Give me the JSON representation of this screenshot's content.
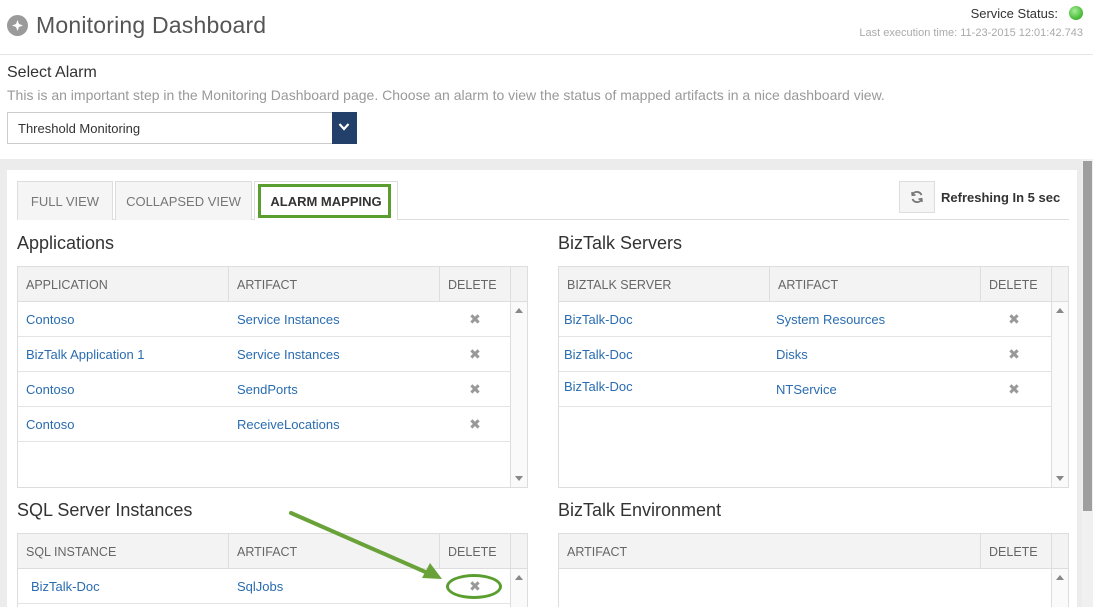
{
  "header": {
    "title": "Monitoring Dashboard",
    "service_status_label": "Service Status:",
    "last_execution": "Last execution time: 11-23-2015 12:01:42.743",
    "status_color": "#4fbf3c"
  },
  "select_alarm": {
    "title": "Select Alarm",
    "description": "This is an important step in the Monitoring Dashboard page. Choose an alarm to view the status of mapped artifacts in a nice dashboard view.",
    "selected": "Threshold Monitoring"
  },
  "tabs": [
    {
      "label": "FULL VIEW"
    },
    {
      "label": "COLLAPSED VIEW"
    },
    {
      "label": "ALARM MAPPING"
    }
  ],
  "refresh": {
    "text": "Refreshing In 5 sec",
    "icon": "refresh-icon"
  },
  "applications": {
    "title": "Applications",
    "headers": [
      "APPLICATION",
      "ARTIFACT",
      "DELETE"
    ],
    "rows": [
      {
        "app": "Contoso",
        "artifact": "Service Instances"
      },
      {
        "app": "BizTalk Application 1",
        "artifact": "Service Instances"
      },
      {
        "app": "Contoso",
        "artifact": "SendPorts"
      },
      {
        "app": "Contoso",
        "artifact": "ReceiveLocations"
      }
    ]
  },
  "biztalk_servers": {
    "title": "BizTalk Servers",
    "headers": [
      "BIZTALK SERVER",
      "ARTIFACT",
      "DELETE"
    ],
    "rows": [
      {
        "server": "BizTalk-Doc",
        "artifact": "System Resources"
      },
      {
        "server": "BizTalk-Doc",
        "artifact": "Disks"
      },
      {
        "server": "BizTalk-Doc",
        "artifact": "NTService"
      }
    ]
  },
  "sql_instances": {
    "title": "SQL Server Instances",
    "headers": [
      "SQL INSTANCE",
      "ARTIFACT",
      "DELETE"
    ],
    "rows": [
      {
        "instance": "BizTalk-Doc",
        "artifact": "SqlJobs"
      }
    ]
  },
  "biztalk_environment": {
    "title": "BizTalk Environment",
    "headers": [
      "ARTIFACT",
      "DELETE"
    ]
  },
  "colors": {
    "link": "#2a6cb0",
    "accent_dark": "#23406b",
    "highlight": "#5a9e2f"
  }
}
